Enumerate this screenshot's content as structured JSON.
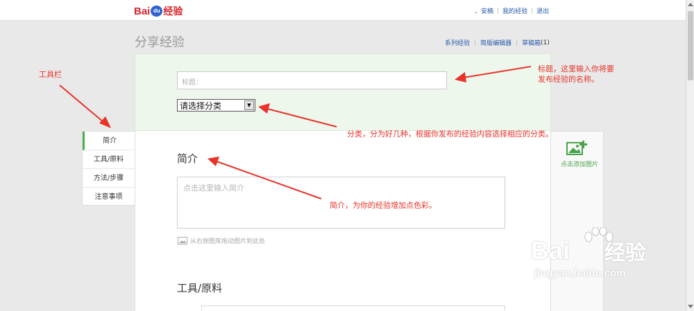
{
  "logo": {
    "bai": "Bai",
    "du": "du",
    "jingyan": "经验"
  },
  "top_nav": {
    "user": "、安楠",
    "my_experience": "我的经验",
    "logout": "退出"
  },
  "page_title": "分享经验",
  "sub_nav": {
    "series": "系列经验",
    "simple_editor": "简版编辑器",
    "drafts": "草稿箱",
    "drafts_count": "(1)"
  },
  "title_input": {
    "placeholder": "标题："
  },
  "category_select": {
    "selected": "请选择分类"
  },
  "toolbar": {
    "items": [
      {
        "label": "简介"
      },
      {
        "label": "工具/原料"
      },
      {
        "label": "方法/步骤"
      },
      {
        "label": "注意事项"
      }
    ]
  },
  "sections": {
    "intro_title": "简介",
    "intro_placeholder": "点击这里输入简介",
    "drag_hint": "从右侧图库拖动图片到此处",
    "tools_title": "工具/原料"
  },
  "right_panel": {
    "add_image_label": "点击添加图片"
  },
  "annotations": {
    "toolbar": "工具栏",
    "title_line1": "标题，这里输入你将要",
    "title_line2": "发布经验的名称。",
    "category": "分类，分为好几种，根据你发布的经验内容选择相应的分类。",
    "intro": "简介，为你的经验增加点色彩。"
  },
  "watermark": {
    "logo_bai": "Bai",
    "logo_jy": "经验",
    "url": "jingyan.baidu.com"
  },
  "colors": {
    "accent_green": "#4ab04a",
    "annotation_red": "#e8322a",
    "link_blue": "#2459a8",
    "brand_red": "#d8232a"
  }
}
